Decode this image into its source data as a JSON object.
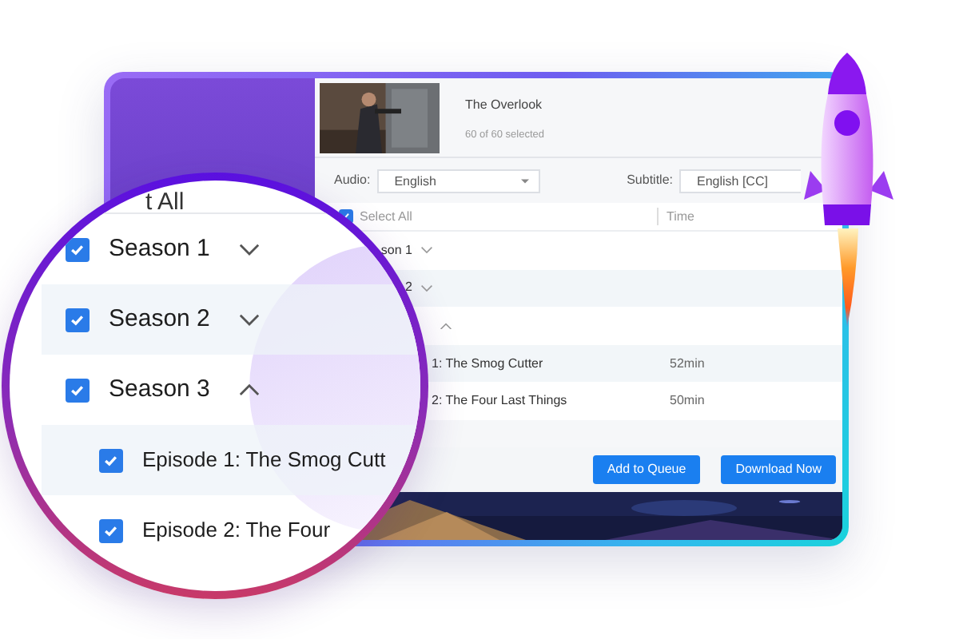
{
  "app": {
    "title": "The Overlook",
    "selection_count": "60 of 60 selected",
    "audio": {
      "label": "Audio:",
      "value": "English"
    },
    "subtitle": {
      "label": "Subtitle:",
      "value": "English [CC]"
    },
    "list_header": {
      "select_all": "Select All",
      "checked": true,
      "time": "Time"
    },
    "rows": [
      {
        "kind": "season",
        "label": "son 1",
        "expanded": false
      },
      {
        "kind": "season",
        "label": "2",
        "expanded": false
      },
      {
        "kind": "season",
        "expanded": true
      },
      {
        "kind": "episode",
        "label": "1: The Smog Cutter",
        "time": "52min"
      },
      {
        "kind": "episode",
        "label": "2: The Four Last Things",
        "time": "50min"
      }
    ],
    "buttons": [
      "Add to Queue",
      "Download Now"
    ]
  },
  "magnifier": {
    "select_all": "t All",
    "rows": [
      {
        "kind": "season",
        "label": "Season 1",
        "checked": true,
        "expanded": false
      },
      {
        "kind": "season",
        "label": "Season 2",
        "checked": true,
        "expanded": false
      },
      {
        "kind": "season",
        "label": "Season 3",
        "checked": true,
        "expanded": true
      },
      {
        "kind": "episode",
        "label": "Episode 1: The Smog Cutt",
        "checked": true
      },
      {
        "kind": "episode",
        "label": "Episode 2: The Four",
        "checked": true
      }
    ]
  }
}
